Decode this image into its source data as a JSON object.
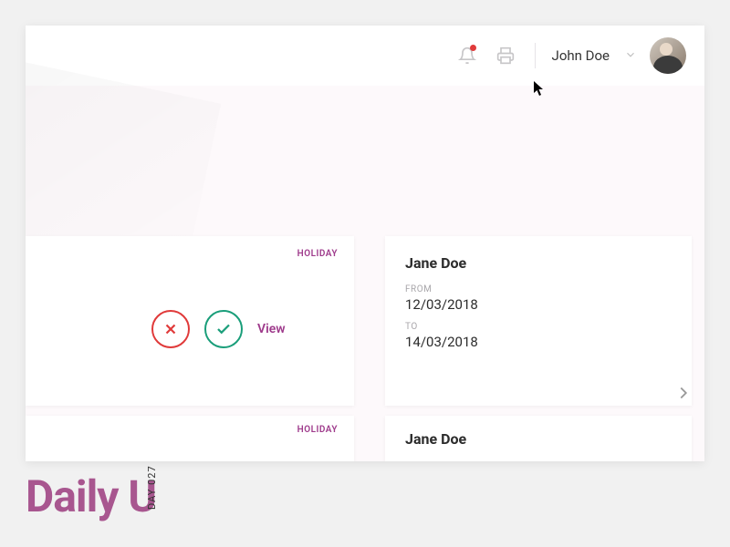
{
  "header": {
    "user_name": "John Doe"
  },
  "cards": {
    "left1": {
      "tag": "HOLIDAY",
      "view_label": "View"
    },
    "left2": {
      "tag": "HOLIDAY"
    },
    "right1": {
      "name": "Jane Doe",
      "from_label": "FROM",
      "from_value": "12/03/2018",
      "to_label": "TO",
      "to_value": "14/03/2018"
    },
    "right2": {
      "name": "Jane Doe"
    }
  },
  "branding": {
    "title": "Daily U",
    "day": "DAY 027"
  }
}
